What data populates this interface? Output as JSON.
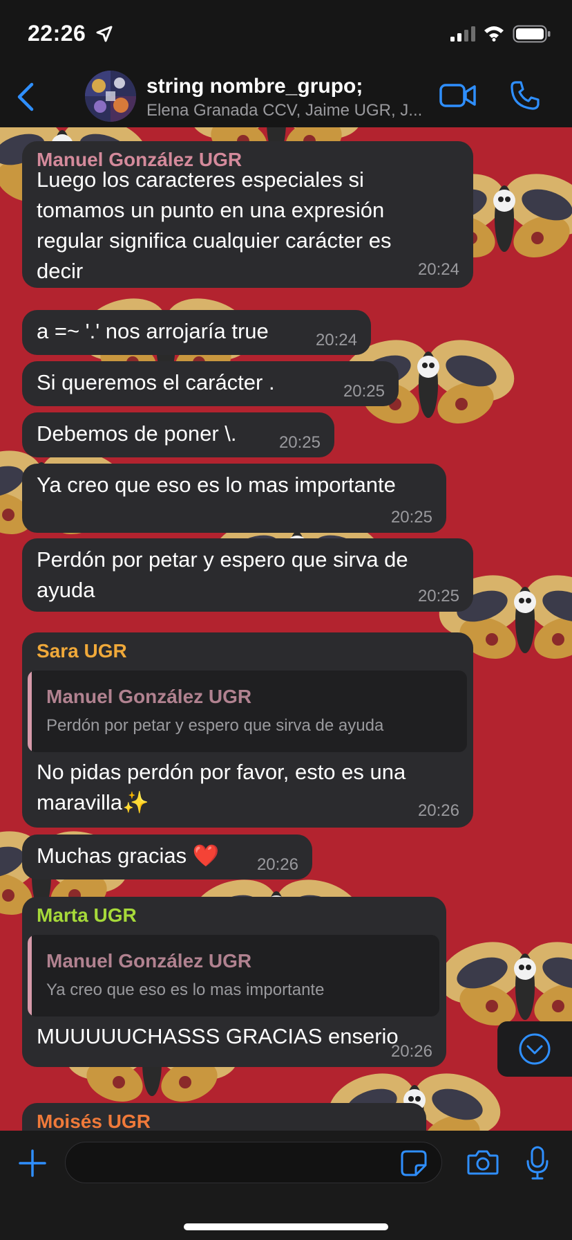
{
  "status_bar": {
    "time": "22:26"
  },
  "header": {
    "title": "string nombre_grupo;",
    "subtitle": "Elena Granada CCV, Jaime UGR, J..."
  },
  "messages": [
    {
      "lines": [
        "Luego los caracteres especiales si",
        "tomamos un punto en una expresión",
        "regular significa cualquier carácter es",
        "decir"
      ],
      "time": "20:24",
      "sender": "Manuel González UGR",
      "sender_color": "#d48a9b"
    },
    {
      "lines": [
        "a =~ '.' nos arrojaría true"
      ],
      "time": "20:24"
    },
    {
      "lines": [
        "Si queremos el carácter ."
      ],
      "time": "20:25"
    },
    {
      "lines": [
        "Debemos de poner \\."
      ],
      "time": "20:25"
    },
    {
      "lines": [
        "Ya creo que eso es lo mas importante"
      ],
      "time": "20:25"
    },
    {
      "lines": [
        "Perdón por petar y espero que sirva de",
        "ayuda"
      ],
      "time": "20:25"
    },
    {
      "sender": "Sara UGR",
      "sender_color": "#f0a93a",
      "quote": {
        "name": "Manuel González UGR",
        "text": "Perdón por petar y espero que sirva de ayuda"
      },
      "lines": [
        "No pidas perdón por favor, esto es una",
        "maravilla✨"
      ],
      "time": "20:26"
    },
    {
      "lines": [
        "Muchas gracias ❤️"
      ],
      "time": "20:26"
    },
    {
      "sender": "Marta UGR",
      "sender_color": "#a6d93a",
      "quote": {
        "name": "Manuel González UGR",
        "text": "Ya creo que eso es lo mas importante"
      },
      "lines": [
        "MUUUUUCHASSS GRACIAS enserio"
      ],
      "time": "20:26"
    },
    {
      "sender": "Moisés UGR",
      "sender_color": "#f07a3a",
      "lines": [],
      "time": ""
    }
  ],
  "colors": {
    "accent": "#2f8fff",
    "bubble": "#2b2b2e",
    "wallpaper": "#b3232f"
  },
  "icons": [
    "location-arrow-icon",
    "signal-icon",
    "wifi-icon",
    "battery-icon",
    "back-chevron-icon",
    "video-call-icon",
    "phone-icon",
    "scroll-down-icon",
    "plus-icon",
    "sticker-icon",
    "camera-icon",
    "microphone-icon"
  ]
}
